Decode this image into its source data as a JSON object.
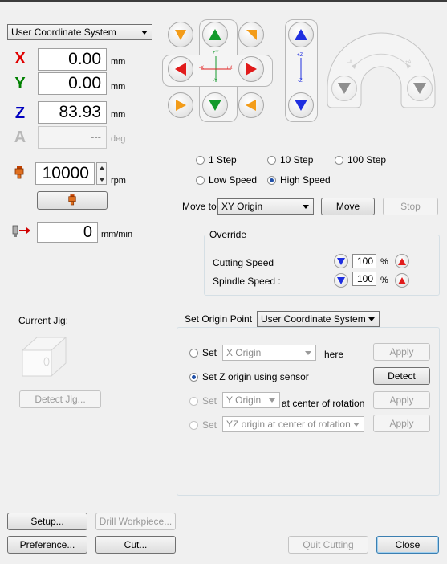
{
  "coordinate": {
    "system_selected": "User Coordinate System",
    "axes": [
      {
        "letter": "X",
        "value": "0.00",
        "unit": "mm",
        "color": "#e00000"
      },
      {
        "letter": "Y",
        "value": "0.00",
        "unit": "mm",
        "color": "#008000"
      },
      {
        "letter": "Z",
        "value": "83.93",
        "unit": "mm",
        "color": "#0000c0"
      },
      {
        "letter": "A",
        "value": "---",
        "unit": "deg",
        "color": "#b0b0b0"
      }
    ]
  },
  "jog": {
    "xy_labels": {
      "plus_y": "+Y",
      "minus_y": "-Y",
      "plus_x": "+X",
      "minus_x": "-X"
    },
    "z_labels": {
      "plus_z": "+Z",
      "minus_z": "-Z"
    },
    "a_labels": {
      "minus_a": "-A",
      "plus_a": "+A"
    },
    "colors": {
      "green": "#139a2c",
      "red": "#e11b1b",
      "orange": "#f39c19",
      "blue": "#1f2fe0",
      "grey": "#8f8f8f"
    }
  },
  "spindle": {
    "value": "10000",
    "unit": "rpm"
  },
  "feed": {
    "value": "0",
    "unit": "mm/min"
  },
  "step": {
    "options": [
      "1 Step",
      "10 Step",
      "100 Step"
    ],
    "selected_index": -1
  },
  "speed": {
    "options": [
      "Low Speed",
      "High Speed"
    ],
    "selected_index": 1
  },
  "move": {
    "label": "Move to",
    "target": "XY Origin",
    "move_button": "Move",
    "stop_button": "Stop"
  },
  "override": {
    "title": "Override",
    "cutting_label": "Cutting Speed",
    "cutting_value": "100",
    "spindle_label": "Spindle Speed :",
    "spindle_value": "100",
    "percent": "%"
  },
  "jig": {
    "label": "Current Jig:",
    "detect_button": "Detect Jig..."
  },
  "origin": {
    "label": "Set Origin Point",
    "system": "User Coordinate System",
    "rows": [
      {
        "prefix": "Set",
        "combo": "X Origin",
        "suffix": "here",
        "button": "Apply",
        "enabled": true,
        "selected": false
      },
      {
        "prefix": "Set Z origin using sensor",
        "combo": "",
        "suffix": "",
        "button": "Detect",
        "enabled": true,
        "selected": true
      },
      {
        "prefix": "Set",
        "combo": "Y Origin",
        "suffix": "at center of rotation",
        "button": "Apply",
        "enabled": false,
        "selected": false
      },
      {
        "prefix": "Set",
        "combo": "YZ origin at center of rotation",
        "suffix": "",
        "button": "Apply",
        "enabled": false,
        "selected": false
      }
    ]
  },
  "footer": {
    "setup": "Setup...",
    "drill": "Drill Workpiece...",
    "preference": "Preference...",
    "cut": "Cut...",
    "quit": "Quit Cutting",
    "close": "Close"
  }
}
